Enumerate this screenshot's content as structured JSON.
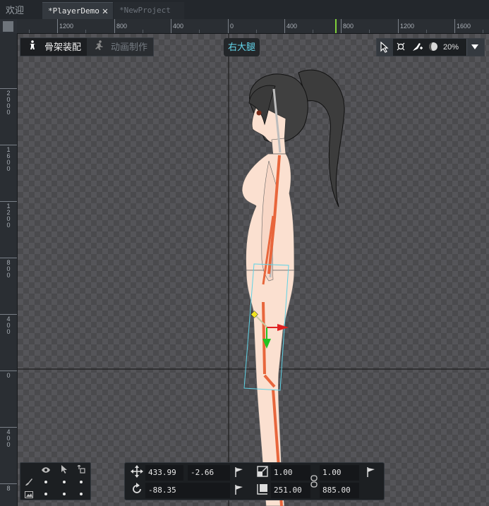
{
  "tabs": [
    {
      "label": "欢迎"
    },
    {
      "label": "*PlayerDemo"
    },
    {
      "label": "*NewProject"
    }
  ],
  "ruler": {
    "horizontal_labels": [
      "1200",
      "800",
      "400",
      "0",
      "400",
      "800",
      "1200",
      "1600"
    ],
    "vertical_labels": [
      "2000",
      "1600",
      "1200",
      "800",
      "400",
      "0",
      "400",
      "8"
    ]
  },
  "modes": {
    "rig_label": "骨架装配",
    "anim_label": "动画制作"
  },
  "selected_bone": "右大腿",
  "toolbar": {
    "zoom": "20%"
  },
  "transform": {
    "pos_x": "433.99",
    "pos_y": "-2.66",
    "rotation": "-88.35",
    "scale_x": "1.00",
    "scale_y": "1.00",
    "size_w": "251.00",
    "size_h": "885.00"
  },
  "colors": {
    "bone_name": "#64d8ee",
    "bone_orange": "#e8663c",
    "selection_box": "#5fd3e6",
    "gizmo_x": "#e02222",
    "gizmo_y": "#22c322",
    "pivot": "#f2e520"
  },
  "icons": {
    "rig_mode": "person-standing-icon",
    "anim_mode": "person-running-icon",
    "select": "cursor-icon",
    "bone_tool": "bone-icon",
    "add_bone": "brush-plus-icon",
    "ik": "sphere-icon",
    "move": "move-icon",
    "rotate": "rotate-icon",
    "scale": "scale-icon",
    "size": "size-icon",
    "key": "flag-icon",
    "visible": "eye-icon",
    "selectable": "pointer-icon",
    "link": "link-icon",
    "bones": "brush-icon",
    "image": "image-icon"
  }
}
